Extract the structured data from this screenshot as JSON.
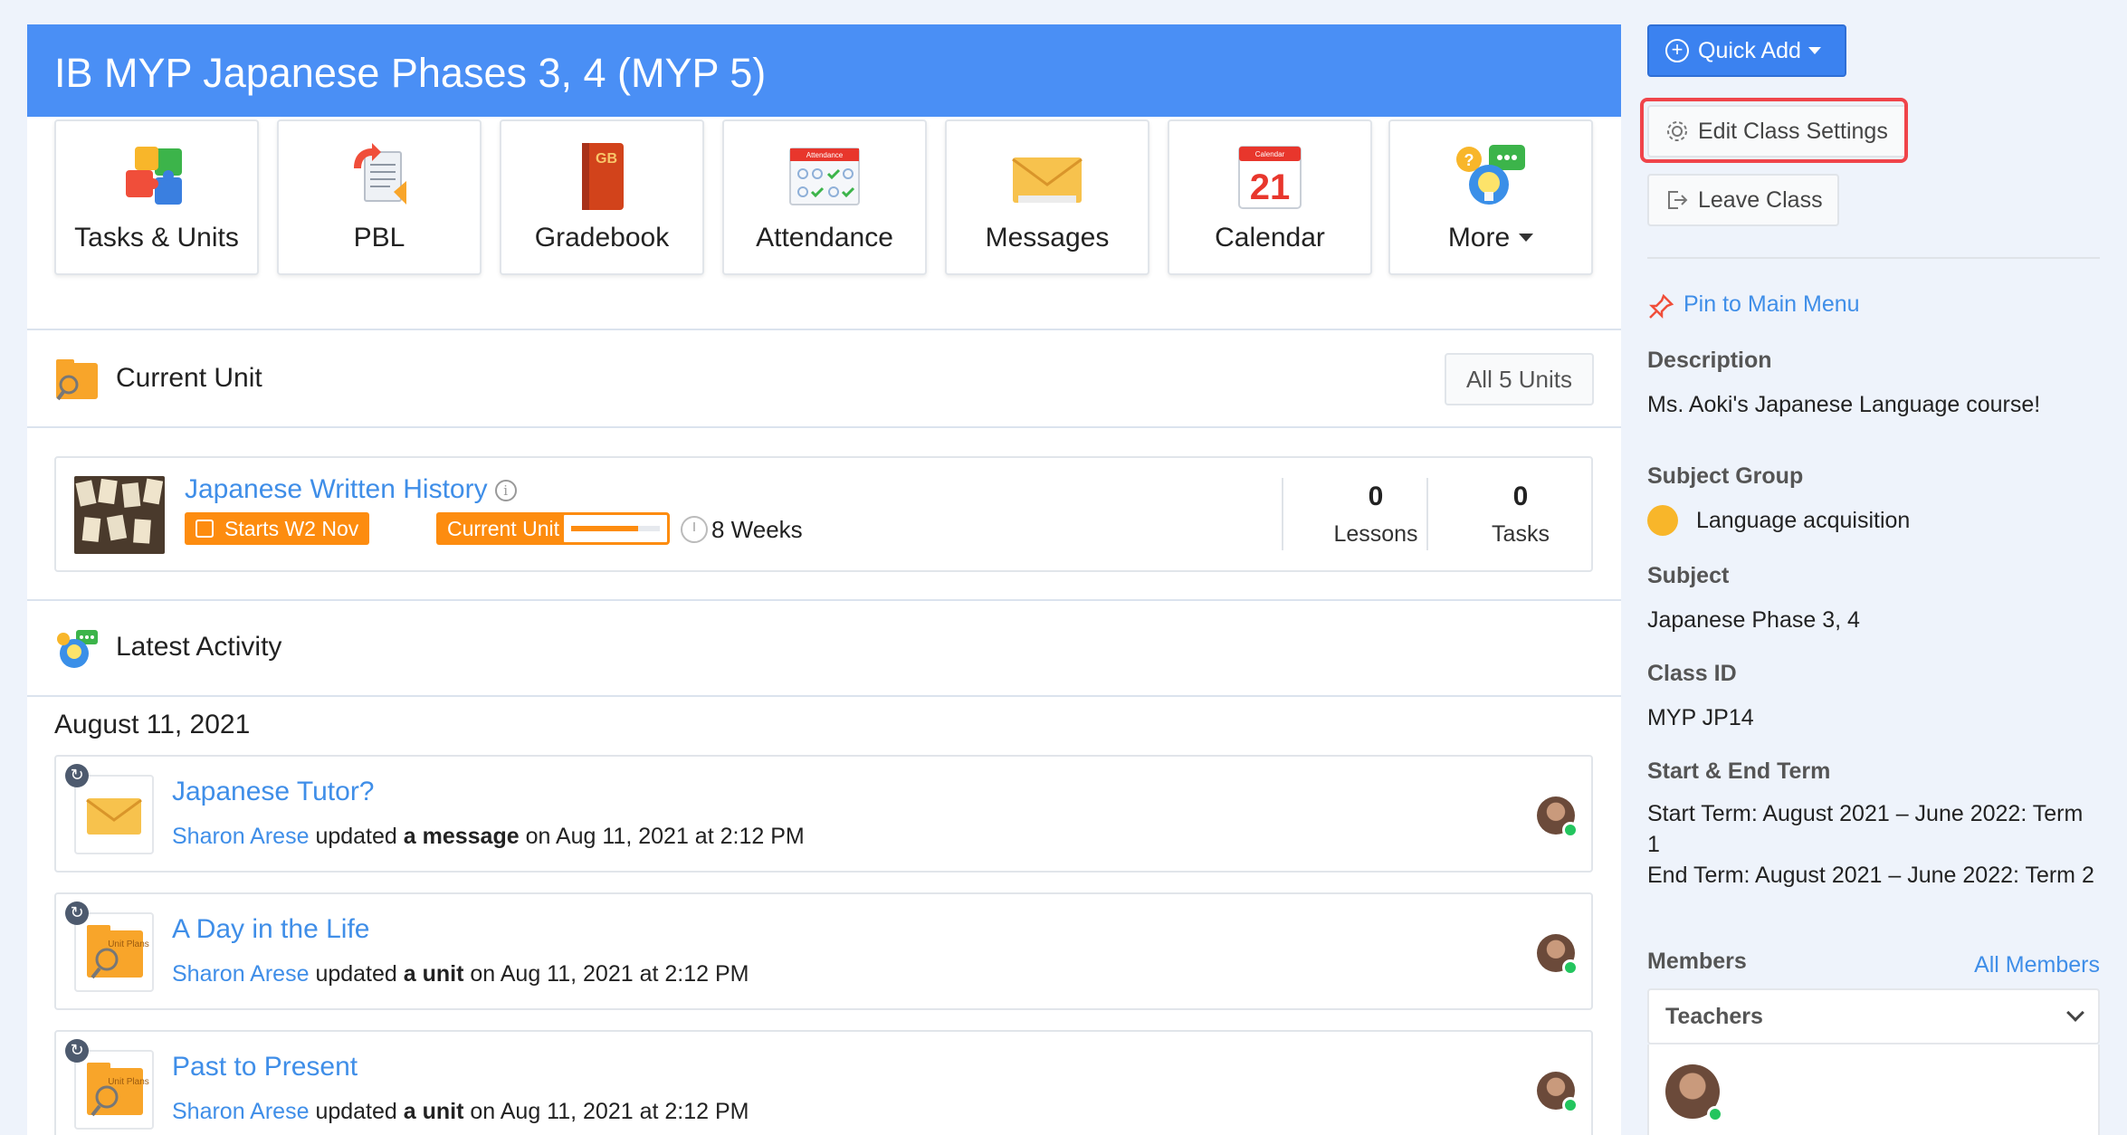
{
  "header": {
    "title": "IB MYP Japanese Phases 3, 4 (MYP 5)"
  },
  "tiles": [
    {
      "label": "Tasks & Units",
      "icon": "puzzle-icon"
    },
    {
      "label": "PBL",
      "icon": "pbl-document-icon"
    },
    {
      "label": "Gradebook",
      "icon": "gradebook-book-icon"
    },
    {
      "label": "Attendance",
      "icon": "attendance-calendar-icon"
    },
    {
      "label": "Messages",
      "icon": "envelope-icon"
    },
    {
      "label": "Calendar",
      "icon": "calendar-icon"
    },
    {
      "label": "More",
      "icon": "more-chat-bulb-icon"
    }
  ],
  "tile_art": {
    "gradebook_text": "GB",
    "attendance_text": "Attendance",
    "calendar_text": "Calendar",
    "calendar_day": "21"
  },
  "current_unit": {
    "heading": "Current Unit",
    "all_units_label": "All 5 Units",
    "title": "Japanese Written History",
    "starts_label": "Starts W2 Nov",
    "status_label": "Current Unit",
    "progress": 0.75,
    "duration": "8 Weeks",
    "lessons_count": "0",
    "lessons_label": "Lessons",
    "tasks_count": "0",
    "tasks_label": "Tasks"
  },
  "latest_activity": {
    "heading": "Latest Activity",
    "date": "August 11, 2021",
    "items": [
      {
        "title": "Japanese Tutor?",
        "user": "Sharon Arese",
        "verb": " updated ",
        "object": "a message",
        "when": " on Aug 11, 2021 at 2:12 PM",
        "icon": "envelope-icon"
      },
      {
        "title": "A Day in the Life",
        "user": "Sharon Arese",
        "verb": " updated ",
        "object": "a unit",
        "when": " on Aug 11, 2021 at 2:12 PM",
        "icon": "unit-plans-folder-icon"
      },
      {
        "title": "Past to Present",
        "user": "Sharon Arese",
        "verb": " updated ",
        "object": "a unit",
        "when": " on Aug 11, 2021 at 2:12 PM",
        "icon": "unit-plans-folder-icon"
      }
    ]
  },
  "unit_plans_art": "Unit Plans",
  "sidebar": {
    "quick_add_label": "Quick Add",
    "edit_settings_label": "Edit Class Settings",
    "leave_class_label": "Leave Class",
    "pin_label": "Pin to Main Menu",
    "description_label": "Description",
    "description_value": "Ms. Aoki's Japanese Language course!",
    "subject_group_label": "Subject Group",
    "subject_group_value": "Language acquisition",
    "subject_label": "Subject",
    "subject_value": "Japanese Phase 3, 4",
    "class_id_label": "Class ID",
    "class_id_value": "MYP JP14",
    "term_label": "Start & End Term",
    "start_term_value": "Start Term: August 2021 – June 2022: Term 1",
    "end_term_value": "End Term: August 2021 – June 2022: Term 2",
    "members_label": "Members",
    "all_members_label": "All Members",
    "teachers_label": "Teachers"
  },
  "colors": {
    "header_blue": "#4a8ff5",
    "link_blue": "#3f8ee8",
    "badge_orange": "#fd8c0f",
    "highlight_red": "#f0444a",
    "online_green": "#23c55e"
  }
}
